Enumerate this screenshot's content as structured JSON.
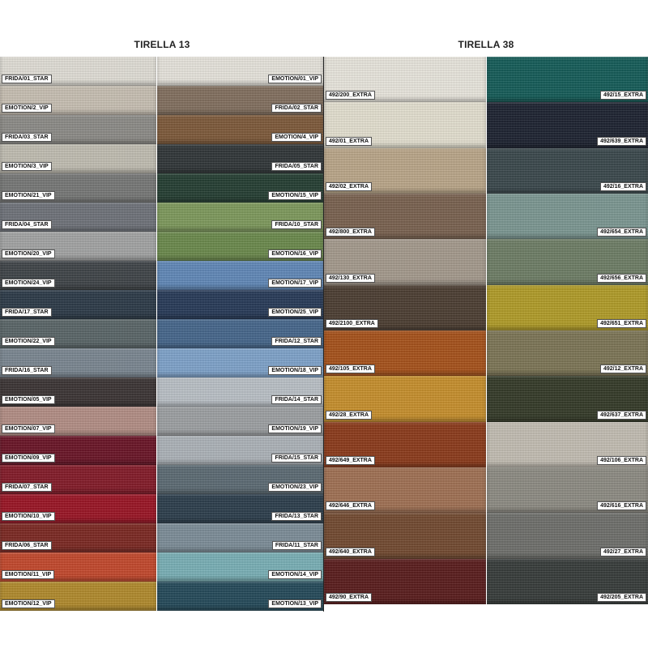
{
  "tirella13": {
    "title": "TIRELLA 13",
    "left_column": [
      {
        "code": "FRIDA/01_STAR",
        "color": "#e3e0d8"
      },
      {
        "code": "EMOTION/2_VIP",
        "color": "#c9c1b4"
      },
      {
        "code": "FRIDA/03_STAR",
        "color": "#8d8c88"
      },
      {
        "code": "EMOTION/3_VIP",
        "color": "#c2bfb3"
      },
      {
        "code": "EMOTION/21_VIP",
        "color": "#777877"
      },
      {
        "code": "FRIDA/04_STAR",
        "color": "#6f737a"
      },
      {
        "code": "EMOTION/20_VIP",
        "color": "#a4a5a5"
      },
      {
        "code": "EMOTION/24_VIP",
        "color": "#3f4448"
      },
      {
        "code": "FRIDA/17_STAR",
        "color": "#2c3a48"
      },
      {
        "code": "EMOTION/22_VIP",
        "color": "#5a6668"
      },
      {
        "code": "FRIDA/16_STAR",
        "color": "#7b8792"
      },
      {
        "code": "EMOTION/05_VIP",
        "color": "#3b3434"
      },
      {
        "code": "EMOTION/07_VIP",
        "color": "#b48f86"
      },
      {
        "code": "EMOTION/09_VIP",
        "color": "#6a1426"
      },
      {
        "code": "FRIDA/07_STAR",
        "color": "#841a28"
      },
      {
        "code": "EMOTION/10_VIP",
        "color": "#9b1424"
      },
      {
        "code": "FRIDA/06_STAR",
        "color": "#7c2822"
      },
      {
        "code": "EMOTION/11_VIP",
        "color": "#c4482c"
      },
      {
        "code": "EMOTION/12_VIP",
        "color": "#b28b2c"
      }
    ],
    "right_column": [
      {
        "code": "EMOTION/01_VIP",
        "color": "#e9e6de"
      },
      {
        "code": "FRIDA/02_STAR",
        "color": "#83705f"
      },
      {
        "code": "EMOTION/4_VIP",
        "color": "#7e5a3a"
      },
      {
        "code": "FRIDA/05_STAR",
        "color": "#303638"
      },
      {
        "code": "EMOTION/15_VIP",
        "color": "#243e32"
      },
      {
        "code": "FRIDA/10_STAR",
        "color": "#7e9a5c"
      },
      {
        "code": "EMOTION/16_VIP",
        "color": "#6b8a4c"
      },
      {
        "code": "EMOTION/17_VIP",
        "color": "#6189b9"
      },
      {
        "code": "EMOTION/25_VIP",
        "color": "#273a58"
      },
      {
        "code": "FRIDA/12_STAR",
        "color": "#46678c"
      },
      {
        "code": "EMOTION/18_VIP",
        "color": "#7fa4cc"
      },
      {
        "code": "FRIDA/14_STAR",
        "color": "#bcc2c8"
      },
      {
        "code": "EMOTION/19_VIP",
        "color": "#9ea1a4"
      },
      {
        "code": "FRIDA/15_STAR",
        "color": "#aeb4ba"
      },
      {
        "code": "EMOTION/23_VIP",
        "color": "#5c6b74"
      },
      {
        "code": "FRIDA/13_STAR",
        "color": "#2c3e4c"
      },
      {
        "code": "FRIDA/11_STAR",
        "color": "#7d8e99"
      },
      {
        "code": "EMOTION/14_VIP",
        "color": "#7ab1b7"
      },
      {
        "code": "EMOTION/13_VIP",
        "color": "#244a5a"
      }
    ]
  },
  "tirella38": {
    "title": "TIRELLA 38",
    "left_column": [
      {
        "code": "492/200_EXTRA",
        "color": "#ebe8df"
      },
      {
        "code": "492/01_EXTRA",
        "color": "#e6e2d2"
      },
      {
        "code": "492/02_EXTRA",
        "color": "#bca88a"
      },
      {
        "code": "492/800_EXTRA",
        "color": "#7a6250"
      },
      {
        "code": "492/130_EXTRA",
        "color": "#a69b8e"
      },
      {
        "code": "492/2100_EXTRA",
        "color": "#4c3e32"
      },
      {
        "code": "492/105_EXTRA",
        "color": "#a8521a"
      },
      {
        "code": "492/28_EXTRA",
        "color": "#c8902c"
      },
      {
        "code": "492/649_EXTRA",
        "color": "#8c3a1a"
      },
      {
        "code": "492/646_EXTRA",
        "color": "#a17154"
      },
      {
        "code": "492/640_EXTRA",
        "color": "#734a30"
      },
      {
        "code": "492/90_EXTRA",
        "color": "#5a1c1c"
      }
    ],
    "right_column": [
      {
        "code": "492/15_EXTRA",
        "color": "#145c58"
      },
      {
        "code": "492/639_EXTRA",
        "color": "#1c2230"
      },
      {
        "code": "492/16_EXTRA",
        "color": "#3a484c"
      },
      {
        "code": "492/654_EXTRA",
        "color": "#7c9893"
      },
      {
        "code": "492/656_EXTRA",
        "color": "#6e7e66"
      },
      {
        "code": "492/651_EXTRA",
        "color": "#b29d28"
      },
      {
        "code": "492/12_EXTRA",
        "color": "#7d7656"
      },
      {
        "code": "492/637_EXTRA",
        "color": "#343a28"
      },
      {
        "code": "492/106_EXTRA",
        "color": "#c4bfb4"
      },
      {
        "code": "492/616_EXTRA",
        "color": "#8e8c84"
      },
      {
        "code": "492/27_EXTRA",
        "color": "#6f706c"
      },
      {
        "code": "492/205_EXTRA",
        "color": "#373c3a"
      }
    ]
  }
}
